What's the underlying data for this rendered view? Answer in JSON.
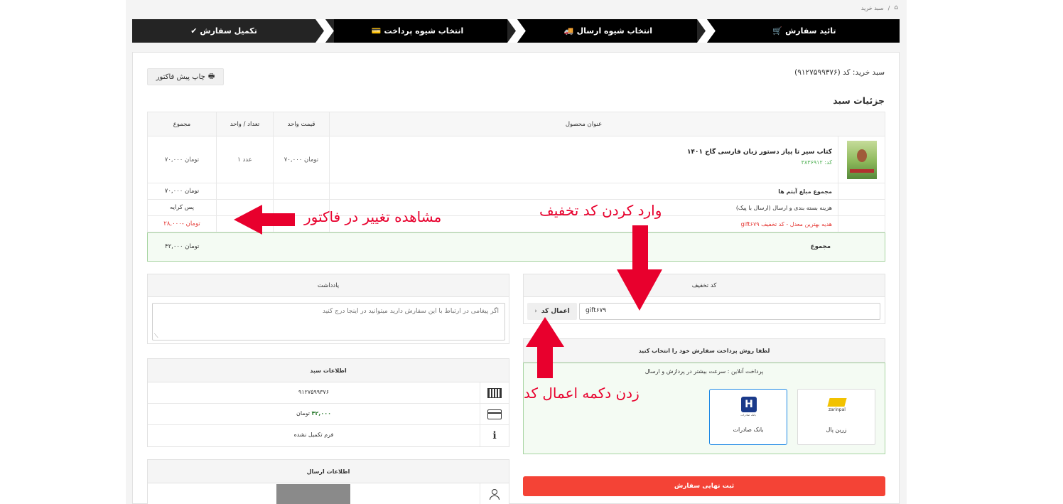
{
  "breadcrumb": {
    "home_icon": "home-icon",
    "separator": "/",
    "current": "سبد خرید"
  },
  "stepper": {
    "steps": [
      {
        "label": "تائید سفارش",
        "icon": "cart-icon"
      },
      {
        "label": "انتخاب شیوه ارسال",
        "icon": "truck-icon"
      },
      {
        "label": "انتخاب شیوه پرداخت",
        "icon": "credit-card-icon"
      },
      {
        "label": "تکمیل سفارش",
        "icon": "check-icon"
      }
    ]
  },
  "cart": {
    "title": "سبد خرید: کد (۹۱۲۷۵۹۹۳۷۶)",
    "print_label": "چاپ پیش فاکتور",
    "details_title": "جزئیات سبد"
  },
  "table": {
    "headers": {
      "title": "عنوان محصول",
      "unit_price": "قیمت واحد",
      "qty": "تعداد / واحد",
      "total": "مجموع"
    },
    "item": {
      "name": "کتاب سیر تا پیاز دستور زبان فارسی گاج ۱۴۰۱",
      "code": "کد: ۳۸۳۶۹۱۲",
      "unit_price": "۷۰,۰۰۰ تومان",
      "qty": "۱ عدد",
      "total": "۷۰,۰۰۰ تومان"
    },
    "summary": [
      {
        "label": "مجموع مبلغ آیتم ها",
        "value": "۷۰,۰۰۰ تومان"
      },
      {
        "label": "هزینه بسته بندی و ارسال (ارسال با پیک)",
        "value": "پس کرایه"
      },
      {
        "label": "هدیه بهترین معدل - کد تخفیف gift۶۷۹",
        "value": "۲۸,۰۰۰- تومان"
      }
    ],
    "grand_label": "مجموع",
    "grand_value": "۴۲,۰۰۰ تومان"
  },
  "discount": {
    "title": "کد تخفیف",
    "value": "gift۶۷۹",
    "apply_label": "اعمال کد"
  },
  "payment": {
    "title": "لطفا روش پرداخت سفارش خود را انتخاب کنید",
    "subtitle": "پرداخت آنلاین : سرعت بیشتر در پردازش و ارسال",
    "options": [
      {
        "label": "زرین پال",
        "logo_text": "zarinpal"
      },
      {
        "label": "بانک صادرات",
        "logo_text": "بانک صادرات"
      }
    ],
    "submit_label": "ثبت نهایی سفارش"
  },
  "note": {
    "title": "یادداشت",
    "placeholder": "اگر پیغامی در ارتباط با این سفارش دارید میتوانید در اینجا درج کنید"
  },
  "cart_info": {
    "title": "اطلاعات سبد",
    "rows": [
      {
        "icon": "barcode-icon",
        "value": "۹۱۲۷۵۹۹۳۷۶"
      },
      {
        "icon": "card-icon",
        "amount": "۴۲,۰۰۰",
        "unit": "تومان"
      },
      {
        "icon": "info-icon",
        "value": "فرم تکمیل نشده"
      }
    ]
  },
  "shipping_info": {
    "title": "اطلاعات ارسال",
    "icon": "user-icon"
  },
  "annotations": {
    "invoice_change": "مشاهده تغییر در فاکتور",
    "enter_code": "وارد کردن کد تخفیف",
    "press_apply": "زدن دکمه اعمال کد"
  },
  "colors": {
    "accent_red": "#e8002d",
    "submit_red": "#f44336",
    "green_border": "#a8d5a2",
    "green_bg": "#f4fbf3"
  }
}
